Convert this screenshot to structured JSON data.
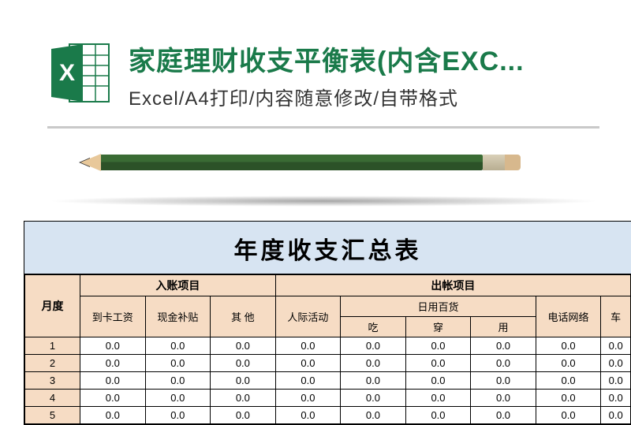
{
  "header": {
    "title": "家庭理财收支平衡表(内含EXC...",
    "subtitle": "Excel/A4打印/内容随意修改/自带格式"
  },
  "sheet": {
    "title": "年度收支汇总表",
    "group_month": "月度",
    "group_in": "入账项目",
    "group_out": "出帐项目",
    "group_daily": "日用百货",
    "cols_in": [
      "到卡工资",
      "现金补贴",
      "其    他"
    ],
    "col_social": "人际活动",
    "cols_daily": [
      "吃",
      "穿",
      "用"
    ],
    "col_phone": "电话网络",
    "col_car": "车",
    "months": [
      "1",
      "2",
      "3",
      "4",
      "5"
    ],
    "value": "0.0"
  },
  "chart_data": {
    "type": "table",
    "title": "年度收支汇总表",
    "row_header": "月度",
    "column_groups": [
      {
        "name": "入账项目",
        "columns": [
          "到卡工资",
          "现金补贴",
          "其他"
        ]
      },
      {
        "name": "出帐项目",
        "columns": [
          "人际活动",
          "日用百货-吃",
          "日用百货-穿",
          "日用百货-用",
          "电话网络",
          "车"
        ]
      }
    ],
    "rows": [
      {
        "month": "1",
        "values": [
          0.0,
          0.0,
          0.0,
          0.0,
          0.0,
          0.0,
          0.0,
          0.0,
          0.0
        ]
      },
      {
        "month": "2",
        "values": [
          0.0,
          0.0,
          0.0,
          0.0,
          0.0,
          0.0,
          0.0,
          0.0,
          0.0
        ]
      },
      {
        "month": "3",
        "values": [
          0.0,
          0.0,
          0.0,
          0.0,
          0.0,
          0.0,
          0.0,
          0.0,
          0.0
        ]
      },
      {
        "month": "4",
        "values": [
          0.0,
          0.0,
          0.0,
          0.0,
          0.0,
          0.0,
          0.0,
          0.0,
          0.0
        ]
      },
      {
        "month": "5",
        "values": [
          0.0,
          0.0,
          0.0,
          0.0,
          0.0,
          0.0,
          0.0,
          0.0,
          0.0
        ]
      }
    ]
  }
}
